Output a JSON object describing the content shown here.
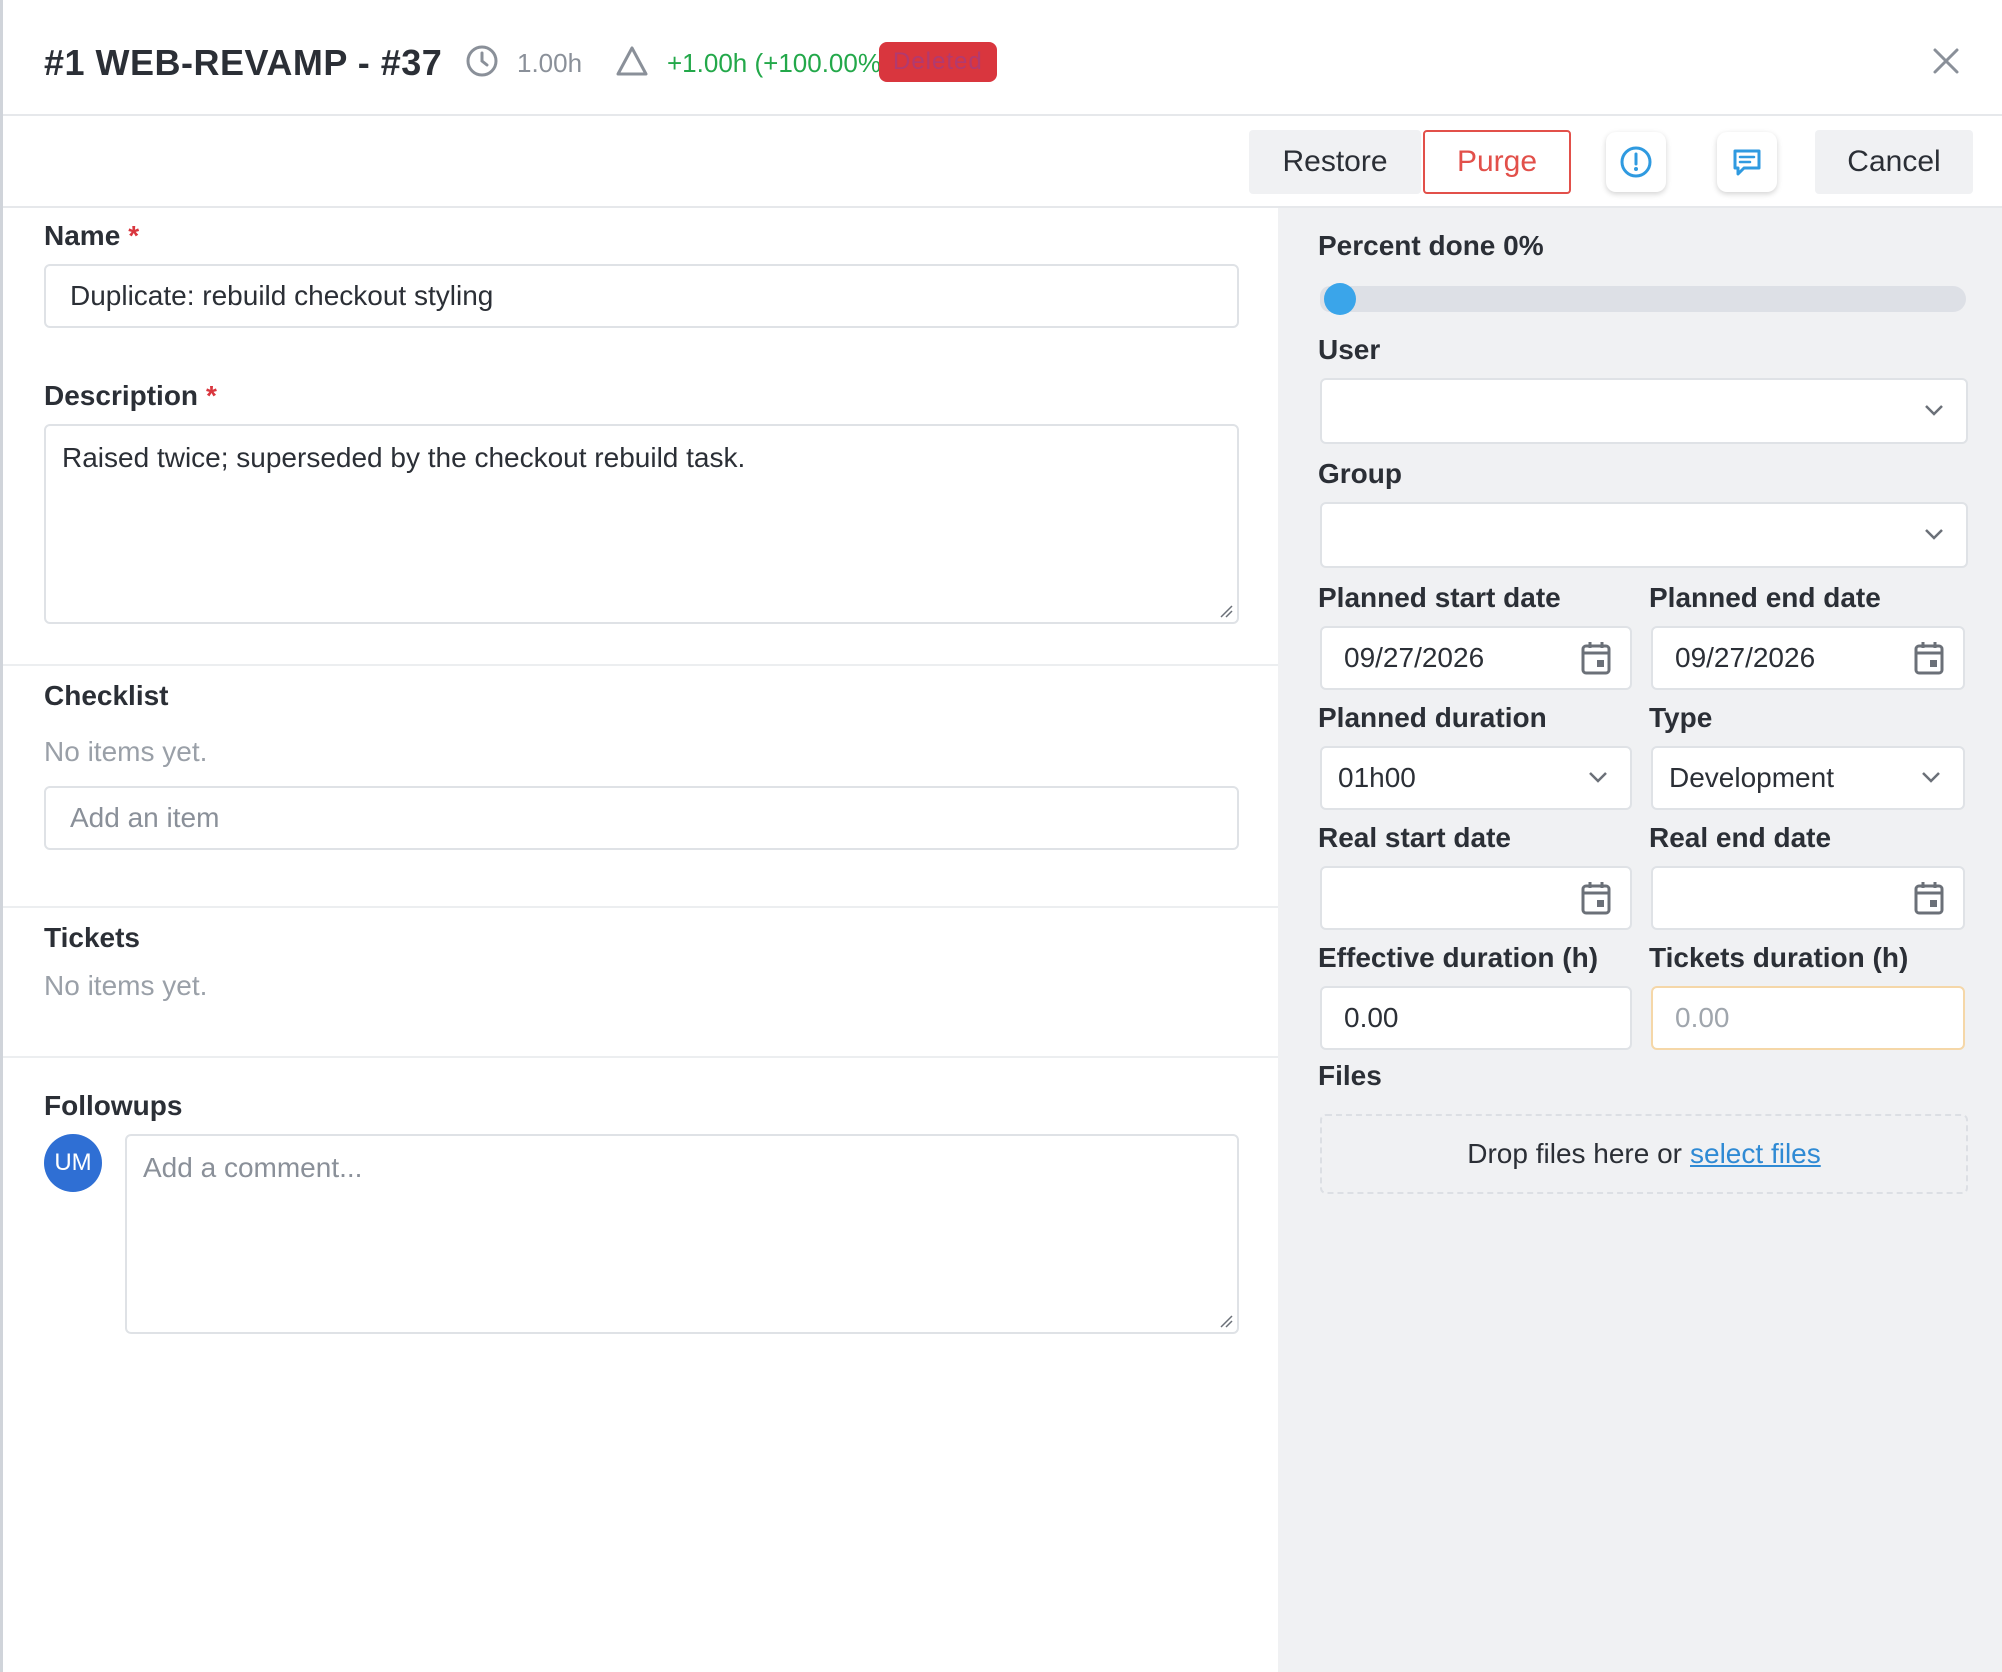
{
  "header": {
    "title": "#1 WEB-REVAMP - #37",
    "estimated_time": "1.00h",
    "delta": "+1.00h (+100.00%)",
    "status_badge": "Deleted"
  },
  "toolbar": {
    "restore_label": "Restore",
    "purge_label": "Purge",
    "cancel_label": "Cancel"
  },
  "form": {
    "name_label": "Name",
    "name_value": "Duplicate: rebuild checkout styling",
    "required_mark": "*",
    "description_label": "Description",
    "description_value": "Raised twice; superseded by the checkout rebuild task.",
    "checklist_label": "Checklist",
    "checklist_empty": "No items yet.",
    "checklist_placeholder": "Add an item",
    "tickets_label": "Tickets",
    "tickets_empty": "No items yet.",
    "followups_label": "Followups",
    "avatar_initials": "UM",
    "comment_placeholder": "Add a comment..."
  },
  "side": {
    "percent_label": "Percent done 0%",
    "percent_value": 0,
    "user_label": "User",
    "user_value": "",
    "group_label": "Group",
    "group_value": "",
    "planned_start_label": "Planned start date",
    "planned_start_value": "09/27/2026",
    "planned_end_label": "Planned end date",
    "planned_end_value": "09/27/2026",
    "planned_duration_label": "Planned duration",
    "planned_duration_value": "01h00",
    "type_label": "Type",
    "type_value": "Development",
    "real_start_label": "Real start date",
    "real_start_value": "",
    "real_end_label": "Real end date",
    "real_end_value": "",
    "effective_duration_label": "Effective duration (h)",
    "effective_duration_value": "0.00",
    "tickets_duration_label": "Tickets duration (h)",
    "tickets_duration_value": "0.00",
    "files_label": "Files",
    "dropzone_text": "Drop files here or",
    "dropzone_link": "select files"
  },
  "colors": {
    "accent_blue": "#3aa5ea",
    "danger_red": "#d9363e",
    "success_green": "#23a84a",
    "panel_gray": "#f0f1f3"
  },
  "icons": [
    "clock-icon",
    "delta-triangle-icon",
    "close-icon",
    "alert-circle-icon",
    "comment-icon",
    "chevron-down-icon",
    "calendar-icon",
    "resize-handle-icon"
  ]
}
